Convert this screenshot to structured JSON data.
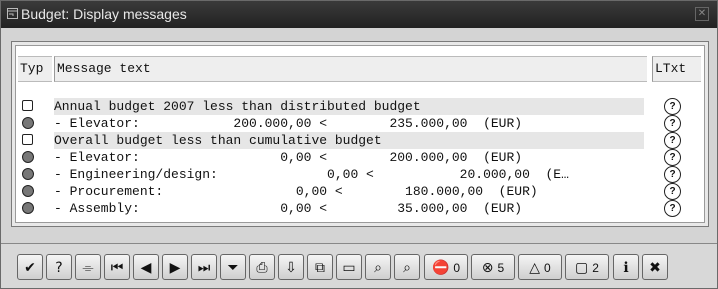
{
  "window": {
    "title": "Budget: Display messages"
  },
  "table": {
    "headers": {
      "typ": "Typ",
      "message": "Message text",
      "ltxt": "LTxt"
    },
    "rows": [
      {
        "type": "info",
        "text": "Annual budget 2007 less than distributed budget",
        "shaded": true
      },
      {
        "type": "error",
        "text": "- Elevator:            200.000,00 <        235.000,00  (EUR)",
        "shaded": false
      },
      {
        "type": "info",
        "text": "Overall budget less than cumulative budget",
        "shaded": true
      },
      {
        "type": "error",
        "text": "- Elevator:                  0,00 <        200.000,00  (EUR)",
        "shaded": false
      },
      {
        "type": "error",
        "text": "- Engineering/design:              0,00 <           20.000,00  (E…",
        "shaded": false
      },
      {
        "type": "error",
        "text": "- Procurement:                 0,00 <        180.000,00  (EUR)",
        "shaded": false
      },
      {
        "type": "error",
        "text": "- Assembly:                  0,00 <         35.000,00  (EUR)",
        "shaded": false
      }
    ]
  },
  "toolbar": {
    "buttons": [
      {
        "name": "continue-button",
        "icon": "check-icon",
        "glyph": "✔"
      },
      {
        "name": "help-button",
        "icon": "help-icon",
        "glyph": "?"
      },
      {
        "name": "technical-info-button",
        "icon": "glasses-icon",
        "glyph": "⌯"
      },
      {
        "name": "first-page-button",
        "icon": "first-icon",
        "glyph": "⏮"
      },
      {
        "name": "previous-button",
        "icon": "previous-icon",
        "glyph": "◀"
      },
      {
        "name": "next-button",
        "icon": "next-icon",
        "glyph": "▶"
      },
      {
        "name": "last-page-button",
        "icon": "last-icon",
        "glyph": "⏭"
      },
      {
        "name": "filter-button",
        "icon": "filter-icon",
        "glyph": "⏷"
      },
      {
        "name": "print-button",
        "icon": "printer-icon",
        "glyph": "⎙"
      },
      {
        "name": "sort-button",
        "icon": "sort-icon",
        "glyph": "⇩"
      },
      {
        "name": "export-button",
        "icon": "export-icon",
        "glyph": "⧉"
      },
      {
        "name": "save-list-button",
        "icon": "document-icon",
        "glyph": "▭"
      },
      {
        "name": "find-button",
        "icon": "binoculars-icon",
        "glyph": "⌕"
      },
      {
        "name": "find-next-button",
        "icon": "binoculars-next-icon",
        "glyph": "⌕"
      }
    ],
    "counters": [
      {
        "name": "abort-messages-counter",
        "icon": "stop-icon",
        "glyph": "⛔",
        "count": "0"
      },
      {
        "name": "error-messages-counter",
        "icon": "error-icon",
        "glyph": "⊗",
        "count": "5"
      },
      {
        "name": "warning-messages-counter",
        "icon": "warning-icon",
        "glyph": "△",
        "count": "0"
      },
      {
        "name": "info-messages-counter",
        "icon": "info-icon",
        "glyph": "▢",
        "count": "2"
      }
    ],
    "trailing": [
      {
        "name": "detail-button",
        "icon": "detail-icon",
        "glyph": "ℹ"
      },
      {
        "name": "cancel-button",
        "icon": "cancel-icon",
        "glyph": "✖"
      }
    ]
  }
}
